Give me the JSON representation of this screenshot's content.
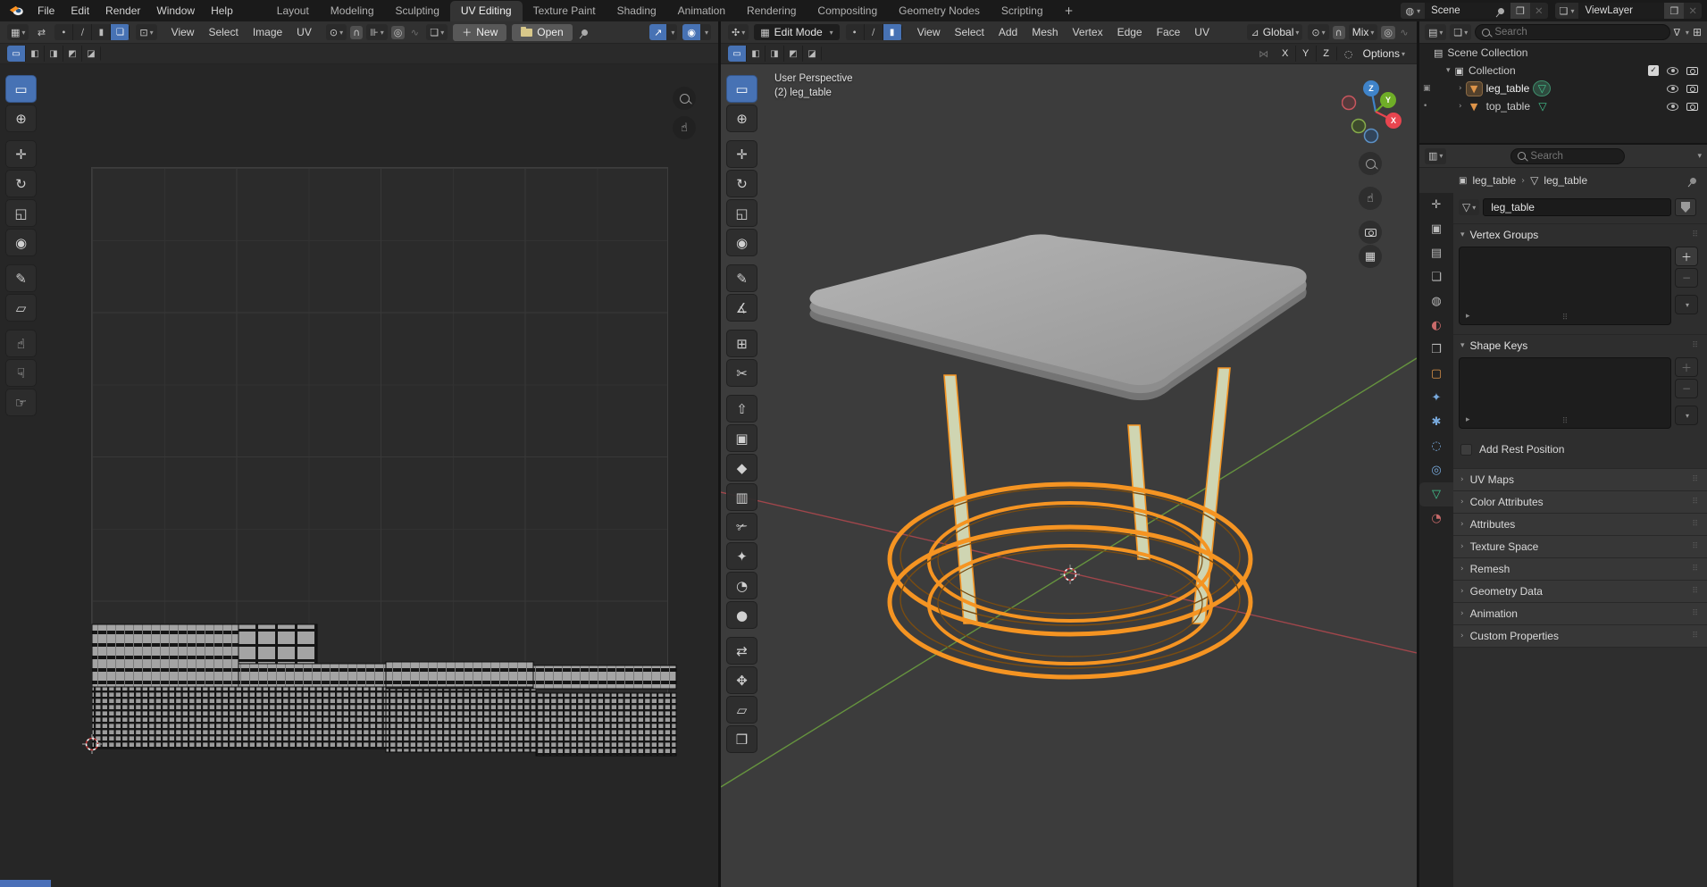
{
  "topbar": {
    "menus": [
      "File",
      "Edit",
      "Render",
      "Window",
      "Help"
    ],
    "tabs": [
      {
        "label": "Layout"
      },
      {
        "label": "Modeling"
      },
      {
        "label": "Sculpting"
      },
      {
        "label": "UV Editing",
        "active": true
      },
      {
        "label": "Texture Paint"
      },
      {
        "label": "Shading"
      },
      {
        "label": "Animation"
      },
      {
        "label": "Rendering"
      },
      {
        "label": "Compositing"
      },
      {
        "label": "Geometry Nodes"
      },
      {
        "label": "Scripting"
      }
    ],
    "add_tab": "+",
    "scene_label": "Scene",
    "viewlayer_label": "ViewLayer"
  },
  "uv": {
    "menus": [
      "View",
      "Select",
      "Image",
      "UV"
    ],
    "new_button": "New",
    "open_button": "Open",
    "select_modes": [
      {
        "name": "uv-vertex-mode",
        "g": "∙"
      },
      {
        "name": "uv-edge-mode",
        "g": "∕"
      },
      {
        "name": "uv-face-mode",
        "g": "▮"
      },
      {
        "name": "uv-island-mode",
        "g": "❏",
        "active": true
      }
    ],
    "select_ops": [
      {
        "name": "select-set",
        "g": "▭",
        "active": true
      },
      {
        "name": "select-extend",
        "g": "◧"
      },
      {
        "name": "select-subtract",
        "g": "◨"
      },
      {
        "name": "select-invert",
        "g": "◩"
      },
      {
        "name": "select-intersect",
        "g": "◪"
      }
    ],
    "tools": [
      {
        "name": "select-box",
        "g": "▭",
        "active": true
      },
      {
        "name": "cursor",
        "g": "⊕"
      },
      {
        "name": "move",
        "g": "✛",
        "gap": true
      },
      {
        "name": "rotate",
        "g": "↻"
      },
      {
        "name": "scale",
        "g": "◱"
      },
      {
        "name": "transform",
        "g": "◉"
      },
      {
        "name": "annotate",
        "g": "✎",
        "gap": true
      },
      {
        "name": "rip-region",
        "g": "▱"
      },
      {
        "name": "grab",
        "g": "☝",
        "gap": true
      },
      {
        "name": "relax",
        "g": "☟"
      },
      {
        "name": "pinch",
        "g": "☞"
      }
    ]
  },
  "vp": {
    "mode": "Edit Mode",
    "menus": [
      "View",
      "Select",
      "Add",
      "Mesh",
      "Vertex",
      "Edge",
      "Face",
      "UV"
    ],
    "orientation": "Global",
    "snap_mode": "Mix",
    "options_label": "Options",
    "axes": [
      "X",
      "Y",
      "Z"
    ],
    "overlay_line1": "User Perspective",
    "overlay_line2": "(2) leg_table",
    "select_modes": [
      {
        "name": "vertex-mode",
        "g": "∙"
      },
      {
        "name": "edge-mode",
        "g": "∕"
      },
      {
        "name": "face-mode",
        "g": "▮",
        "active": true
      }
    ],
    "select_ops": [
      {
        "name": "select-set",
        "g": "▭",
        "active": true
      },
      {
        "name": "select-extend",
        "g": "◧"
      },
      {
        "name": "select-subtract",
        "g": "◨"
      },
      {
        "name": "select-invert",
        "g": "◩"
      },
      {
        "name": "select-intersect",
        "g": "◪"
      }
    ],
    "tools": [
      {
        "name": "select-box",
        "g": "▭",
        "active": true
      },
      {
        "name": "cursor",
        "g": "⊕"
      },
      {
        "name": "move",
        "g": "✛",
        "gap": true
      },
      {
        "name": "rotate",
        "g": "↻"
      },
      {
        "name": "scale",
        "g": "◱"
      },
      {
        "name": "transform",
        "g": "◉"
      },
      {
        "name": "annotate",
        "g": "✎",
        "gap": true
      },
      {
        "name": "measure",
        "g": "∡"
      },
      {
        "name": "add-cube",
        "g": "⊞",
        "gap": true
      },
      {
        "name": "knife-bisect",
        "g": "✂"
      },
      {
        "name": "extrude-region",
        "g": "⇧",
        "gap": true
      },
      {
        "name": "inset-faces",
        "g": "▣"
      },
      {
        "name": "bevel",
        "g": "◆"
      },
      {
        "name": "loop-cut",
        "g": "▥"
      },
      {
        "name": "knife",
        "g": "✃"
      },
      {
        "name": "poly-build",
        "g": "✦"
      },
      {
        "name": "spin",
        "g": "◔"
      },
      {
        "name": "smooth",
        "g": "●"
      },
      {
        "name": "edge-slide",
        "g": "⇄",
        "gap": true
      },
      {
        "name": "shrink-fatten",
        "g": "✥"
      },
      {
        "name": "shear",
        "g": "▱"
      },
      {
        "name": "rip-region",
        "g": "❒"
      }
    ]
  },
  "outliner": {
    "search_placeholder": "Search",
    "rows": [
      {
        "label": "Scene Collection"
      },
      {
        "label": "Collection"
      },
      {
        "label": "leg_table"
      },
      {
        "label": "top_table"
      }
    ]
  },
  "props": {
    "search_placeholder": "Search",
    "breadcrumb_object": "leg_table",
    "breadcrumb_data": "leg_table",
    "name_value": "leg_table",
    "vertex_groups_title": "Vertex Groups",
    "shape_keys_title": "Shape Keys",
    "add_rest_position": "Add Rest Position",
    "collapsed": [
      "UV Maps",
      "Color Attributes",
      "Attributes",
      "Texture Space",
      "Remesh",
      "Geometry Data",
      "Animation",
      "Custom Properties"
    ],
    "rail": [
      {
        "name": "tab-tool",
        "g": "✛",
        "cls": "c-gray"
      },
      {
        "name": "tab-render",
        "g": "▣",
        "cls": "c-gray"
      },
      {
        "name": "tab-output",
        "g": "▤",
        "cls": "c-gray"
      },
      {
        "name": "tab-view-layer",
        "g": "❏",
        "cls": "c-gray"
      },
      {
        "name": "tab-scene",
        "g": "◍",
        "cls": "c-gray"
      },
      {
        "name": "tab-world",
        "g": "◐",
        "cls": "c-red"
      },
      {
        "name": "tab-collection",
        "g": "❒",
        "cls": "c-gray"
      },
      {
        "name": "tab-object",
        "g": "▢",
        "cls": "c-orange"
      },
      {
        "name": "tab-modifiers",
        "g": "✦",
        "cls": "c-blue"
      },
      {
        "name": "tab-particles",
        "g": "✱",
        "cls": "c-blue"
      },
      {
        "name": "tab-physics",
        "g": "◌",
        "cls": "c-blue"
      },
      {
        "name": "tab-constraints",
        "g": "◎",
        "cls": "c-blue"
      },
      {
        "name": "tab-object-data",
        "g": "▽",
        "cls": "c-green",
        "active": true
      },
      {
        "name": "tab-material",
        "g": "◔",
        "cls": "c-red"
      }
    ]
  },
  "colors": {
    "accent_blue": "#4772b4",
    "selection_orange": "#f59422",
    "axis_x_red": "#b2484e",
    "axis_y_green": "#6da33f",
    "mesh_face_fill": "#cfd5b2",
    "table_gray": "#a6a6a6"
  }
}
